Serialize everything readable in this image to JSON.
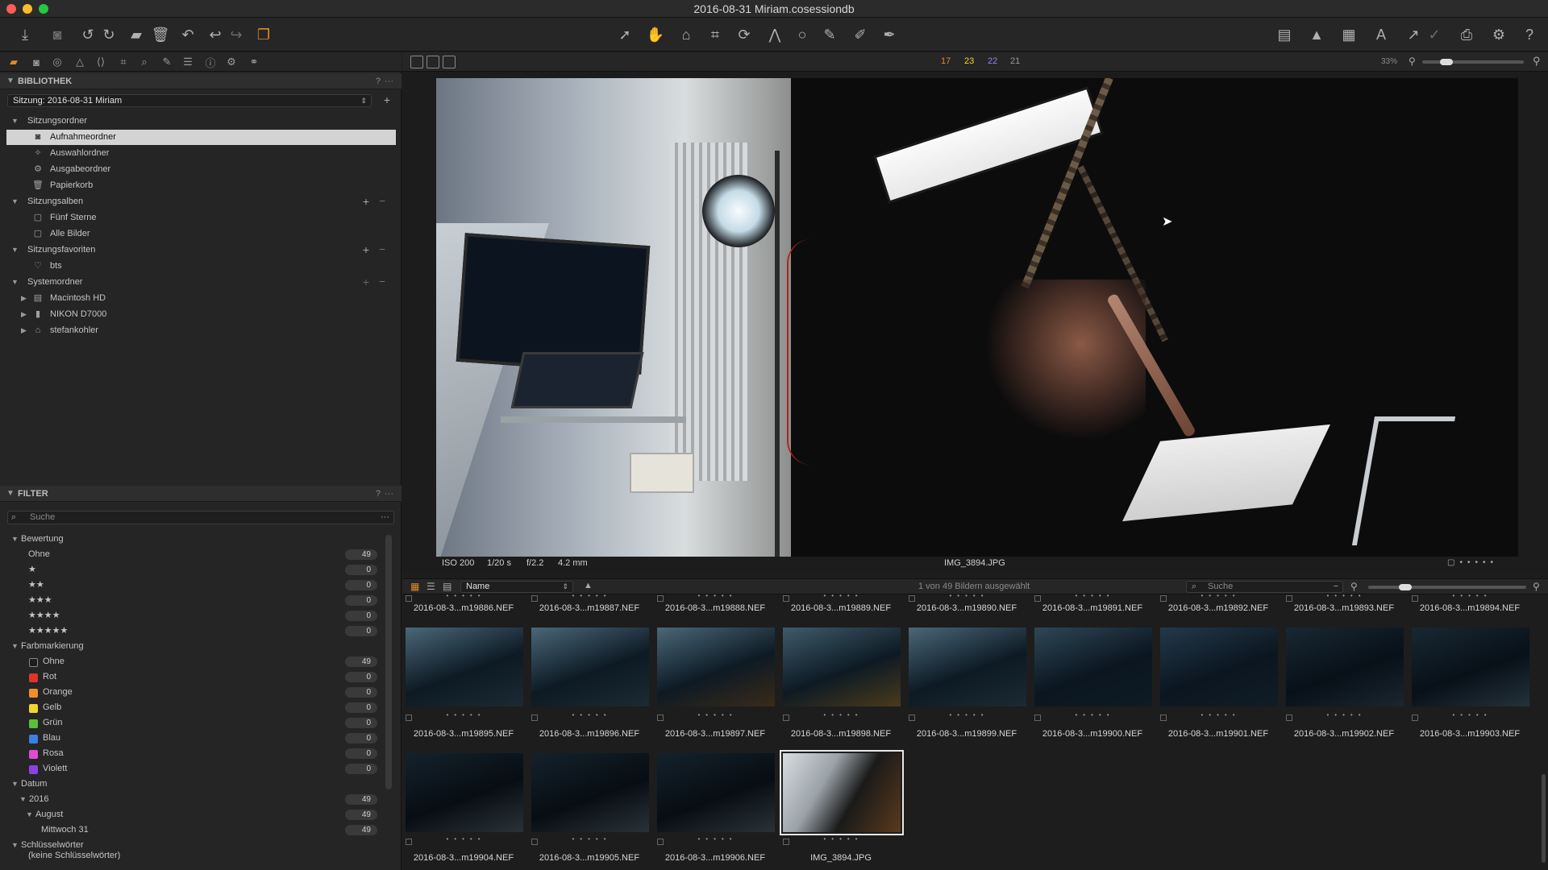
{
  "window": {
    "title": "2016-08-31 Miriam.cosessiondb"
  },
  "colors": {
    "accent": "#e0892a",
    "selection": "#d3d3d3",
    "bg": "#1d1d1d"
  },
  "toolbar": {
    "left_icons": [
      "import-icon",
      "camera-icon",
      "rotate-left-icon",
      "rotate-right-icon",
      "move-to-folder-icon",
      "trash-icon",
      "undo-all-icon",
      "undo-icon",
      "redo-icon",
      "variants-icon"
    ],
    "center_icons": [
      "select-cursor-icon",
      "pan-hand-icon",
      "loupe-icon",
      "crop-icon",
      "rotate-tool-icon",
      "keystone-icon",
      "spot-icon",
      "brush-icon",
      "eraser-icon",
      "picker-icon"
    ],
    "right_icons": [
      "grid-view-icon",
      "warning-icon",
      "grid-overlay-icon",
      "text-icon",
      "edit-icon",
      "copy-adjust-icon",
      "print-icon",
      "settings-gear-icon",
      "help-icon"
    ]
  },
  "library": {
    "header": "BIBLIOTHEK",
    "session": "Sitzung: 2016-08-31 Miriam",
    "sections": [
      {
        "label": "Sitzungsordner",
        "items": [
          "Aufnahmeordner",
          "Auswahlordner",
          "Ausgabeordner",
          "Papierkorb"
        ]
      },
      {
        "label": "Sitzungsalben",
        "items": [
          "Fünf Sterne",
          "Alle Bilder"
        ]
      },
      {
        "label": "Sitzungsfavoriten",
        "items": [
          "bts"
        ]
      },
      {
        "label": "Systemordner",
        "items": [
          "Macintosh HD",
          "NIKON D7000",
          "stefankohler"
        ]
      }
    ]
  },
  "filter": {
    "header": "FILTER",
    "search_placeholder": "Suche",
    "rating": {
      "label": "Bewertung",
      "rows": [
        {
          "label": "Ohne",
          "count": "49"
        },
        {
          "label": "★",
          "count": "0"
        },
        {
          "label": "★★",
          "count": "0"
        },
        {
          "label": "★★★",
          "count": "0"
        },
        {
          "label": "★★★★",
          "count": "0"
        },
        {
          "label": "★★★★★",
          "count": "0"
        }
      ]
    },
    "colors": {
      "label": "Farbmarkierung",
      "rows": [
        {
          "label": "Ohne",
          "count": "49",
          "color": "#1d1d1d"
        },
        {
          "label": "Rot",
          "count": "0",
          "color": "#e0342a"
        },
        {
          "label": "Orange",
          "count": "0",
          "color": "#f0902a"
        },
        {
          "label": "Gelb",
          "count": "0",
          "color": "#f2d52b"
        },
        {
          "label": "Grün",
          "count": "0",
          "color": "#5cbf3c"
        },
        {
          "label": "Blau",
          "count": "0",
          "color": "#3b7fe0"
        },
        {
          "label": "Rosa",
          "count": "0",
          "color": "#e04bd0"
        },
        {
          "label": "Violett",
          "count": "0",
          "color": "#8a42e0"
        }
      ]
    },
    "date": {
      "label": "Datum",
      "rows": [
        {
          "label": "2016",
          "count": "49"
        },
        {
          "label": "August",
          "count": "49"
        },
        {
          "label": "Mittwoch 31",
          "count": "49"
        }
      ]
    },
    "keywords_label": "Schlüsselwörter",
    "keywords_partial": "(keine Schlüsselwörter)"
  },
  "viewer": {
    "page_numbers": [
      "17",
      "23",
      "22",
      "21"
    ],
    "zoom": "33%",
    "iso": "ISO 200",
    "shutter": "1/20 s",
    "aperture": "f/2.2",
    "focal": "4.2 mm",
    "filename": "IMG_3894.JPG"
  },
  "browser": {
    "sort_label": "Name",
    "status": "1 von 49 Bildern ausgewählt",
    "search_placeholder": "Suche",
    "row0_names": [
      "2016-08-3...m19886.NEF",
      "2016-08-3...m19887.NEF",
      "2016-08-3...m19888.NEF",
      "2016-08-3...m19889.NEF",
      "2016-08-3...m19890.NEF",
      "2016-08-3...m19891.NEF",
      "2016-08-3...m19892.NEF",
      "2016-08-3...m19893.NEF",
      "2016-08-3...m19894.NEF"
    ],
    "row1_names": [
      "2016-08-3...m19895.NEF",
      "2016-08-3...m19896.NEF",
      "2016-08-3...m19897.NEF",
      "2016-08-3...m19898.NEF",
      "2016-08-3...m19899.NEF",
      "2016-08-3...m19900.NEF",
      "2016-08-3...m19901.NEF",
      "2016-08-3...m19902.NEF",
      "2016-08-3...m19903.NEF"
    ],
    "row2_names": [
      "2016-08-3...m19904.NEF",
      "2016-08-3...m19905.NEF",
      "2016-08-3...m19906.NEF",
      "IMG_3894.JPG"
    ],
    "stars": "•••••"
  }
}
